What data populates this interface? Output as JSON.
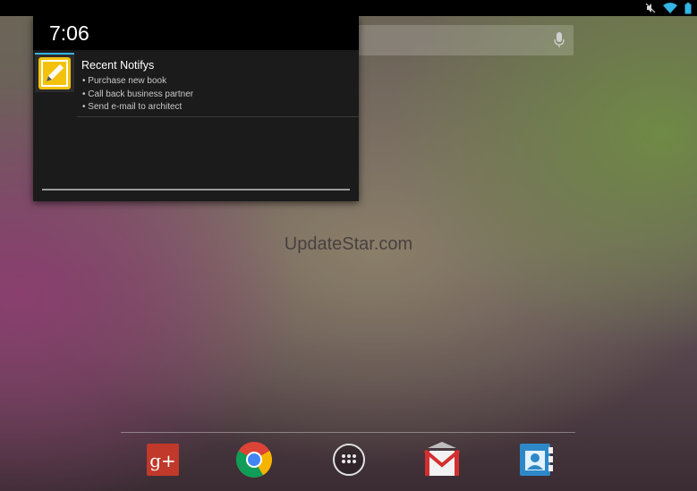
{
  "status_bar": {
    "icons": [
      "mute-icon",
      "wifi-icon",
      "battery-icon"
    ]
  },
  "search": {
    "icon": "mic-icon"
  },
  "notification_panel": {
    "time": "7:06",
    "notification": {
      "icon": "notes-pencil-icon",
      "title": "Recent Notifys",
      "lines": [
        "• Purchase new book",
        "• Call back business partner",
        "• Send e-mail to architect"
      ]
    }
  },
  "watermark": "UpdateStar.com",
  "dock": {
    "items": [
      {
        "name": "google-plus",
        "icon": "google-plus-icon"
      },
      {
        "name": "chrome",
        "icon": "chrome-icon"
      },
      {
        "name": "app-drawer",
        "icon": "apps-grid-icon"
      },
      {
        "name": "gmail",
        "icon": "gmail-icon"
      },
      {
        "name": "contacts",
        "icon": "contacts-icon"
      }
    ]
  },
  "colors": {
    "accent": "#33b5e5",
    "notes_yellow": "#f4c20d",
    "google_plus_red": "#c0392b"
  }
}
